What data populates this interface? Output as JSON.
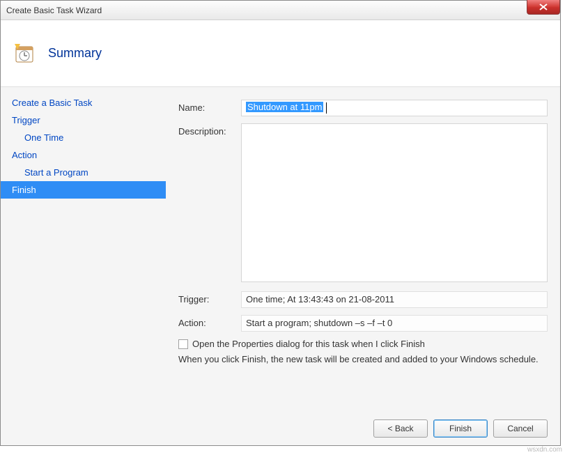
{
  "window": {
    "title": "Create Basic Task Wizard"
  },
  "header": {
    "title": "Summary"
  },
  "sidebar": {
    "items": [
      {
        "label": "Create a Basic Task",
        "sub": false,
        "selected": false
      },
      {
        "label": "Trigger",
        "sub": false,
        "selected": false
      },
      {
        "label": "One Time",
        "sub": true,
        "selected": false
      },
      {
        "label": "Action",
        "sub": false,
        "selected": false
      },
      {
        "label": "Start a Program",
        "sub": true,
        "selected": false
      },
      {
        "label": "Finish",
        "sub": false,
        "selected": true
      }
    ]
  },
  "form": {
    "name_label": "Name:",
    "name_value": "Shutdown at 11pm",
    "description_label": "Description:",
    "description_value": "",
    "trigger_label": "Trigger:",
    "trigger_value": "One time; At 13:43:43 on 21-08-2011",
    "action_label": "Action:",
    "action_value": "Start a program; shutdown –s –f –t 0",
    "checkbox_label": "Open the Properties dialog for this task when I click Finish",
    "info_text": "When you click Finish, the new task will be created and added to your Windows schedule."
  },
  "buttons": {
    "back": "< Back",
    "finish": "Finish",
    "cancel": "Cancel"
  },
  "watermark": "wsxdn.com"
}
